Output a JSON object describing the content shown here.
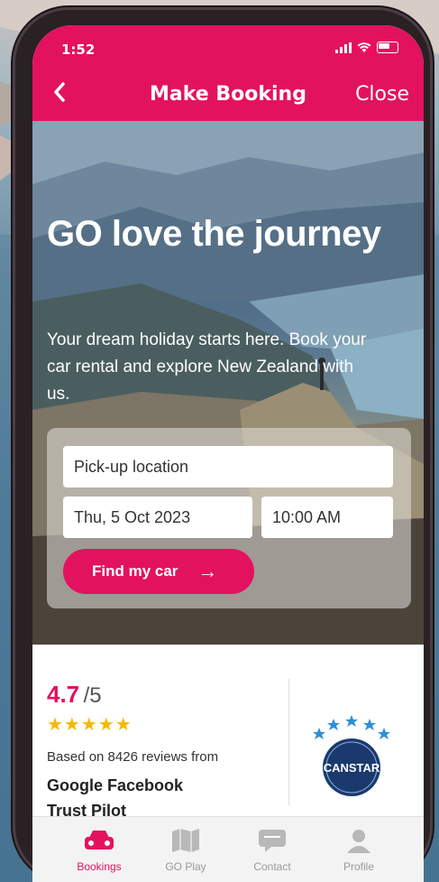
{
  "status_bar": {
    "time": "1:52"
  },
  "header": {
    "back_icon": "chevron-left-icon",
    "title": "Make Booking",
    "close_label": "Close"
  },
  "hero": {
    "title": "GO love the journey",
    "subtitle": "Your dream holiday starts here. Book your car rental and explore New Zealand with us."
  },
  "booking_form": {
    "pickup_location": "Pick-up location",
    "pickup_date": "Thu, 5 Oct 2023",
    "pickup_time": "10:00 AM",
    "submit_label": "Find my car"
  },
  "reviews": {
    "score": "4.7",
    "out_of": "/5",
    "stars": "★★★★★",
    "based_on": "Based on 8426 reviews from",
    "sources": "Google  Facebook",
    "sources_2": "Trust Pilot",
    "award_name": "CANSTAR"
  },
  "tabs": [
    {
      "label": "Bookings",
      "icon": "car-icon",
      "active": true
    },
    {
      "label": "GO Play",
      "icon": "map-icon",
      "active": false
    },
    {
      "label": "Contact",
      "icon": "chat-icon",
      "active": false
    },
    {
      "label": "Profile",
      "icon": "person-icon",
      "active": false
    }
  ],
  "colors": {
    "brand": "#e3125f",
    "star": "#f6b800"
  }
}
